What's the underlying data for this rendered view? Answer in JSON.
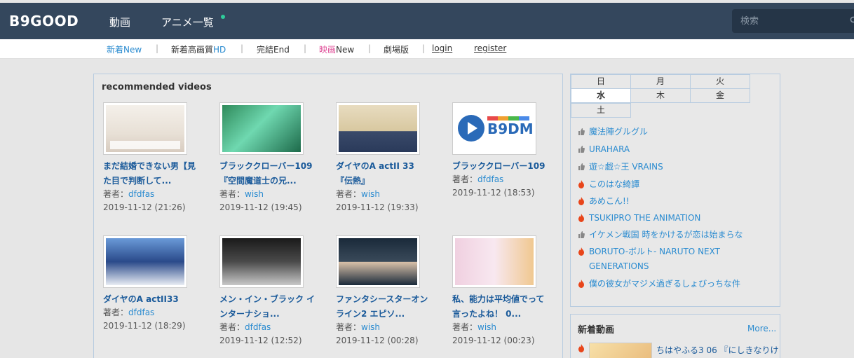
{
  "header": {
    "logo": "B9GOOD",
    "nav": [
      "動画",
      "アニメ一覧"
    ],
    "search_placeholder": "検索"
  },
  "subnav": {
    "items": [
      {
        "jp": "新着",
        "en": "New"
      },
      {
        "jp": "新着高画質",
        "en": "HD"
      },
      {
        "jp": "完結",
        "en": "End"
      },
      {
        "jp": "映画",
        "en": "New"
      },
      {
        "jp": "劇場版",
        "en": ""
      }
    ],
    "login": "login",
    "register": "register"
  },
  "recommended": {
    "title": "recommended videos",
    "author_label": "著者：",
    "videos": [
      {
        "title": "まだ結婚できない男【見た目で判断して...",
        "author": "dfdfas",
        "date": "2019-11-12 (21:26)"
      },
      {
        "title": "ブラッククローバー109『空間魔道士の兄...",
        "author": "wish",
        "date": "2019-11-12 (19:45)"
      },
      {
        "title": "ダイヤのA actII 33 『伝熱』",
        "author": "wish",
        "date": "2019-11-12 (19:33)"
      },
      {
        "title": "ブラッククローバー109",
        "author": "dfdfas",
        "date": "2019-11-12 (18:53)"
      },
      {
        "title": "ダイヤのA actII33",
        "author": "dfdfas",
        "date": "2019-11-12 (18:29)"
      },
      {
        "title": "メン・イン・ブラック インターナショ...",
        "author": "dfdfas",
        "date": "2019-11-12 (12:52)"
      },
      {
        "title": "ファンタシースターオンライン2 エピソ...",
        "author": "wish",
        "date": "2019-11-12 (00:28)"
      },
      {
        "title": "私、能力は平均値でって言ったよね！ 0...",
        "author": "wish",
        "date": "2019-11-12 (00:23)"
      }
    ],
    "thumb_logo": "B9DM"
  },
  "schedule": {
    "days": [
      "日",
      "月",
      "火",
      "水",
      "木",
      "金",
      "土"
    ],
    "active_day": "水",
    "anime": [
      {
        "title": "魔法陣グルグル",
        "icon": "thumb-icon"
      },
      {
        "title": "URAHARA",
        "icon": "thumb-icon"
      },
      {
        "title": "遊☆戯☆王 VRAINS",
        "icon": "thumb-icon"
      },
      {
        "title": "このはな綺譚",
        "icon": "fire-icon"
      },
      {
        "title": "あめこん!!",
        "icon": "fire-icon"
      },
      {
        "title": "TSUKIPRO THE ANIMATION",
        "icon": "fire-icon"
      },
      {
        "title": "イケメン戦国 時をかけるが恋は始まらな",
        "icon": "thumb-icon"
      },
      {
        "title": "BORUTO-ボルト- NARUTO NEXT GENERATIONS",
        "icon": "fire-icon"
      },
      {
        "title": "僕の彼女がマジメ過ぎるしょびっちな件",
        "icon": "fire-icon"
      }
    ]
  },
  "new_videos": {
    "title": "新着動画",
    "more": "More...",
    "first_title": "ちはやふる3 06 『にしきなりけ"
  },
  "colors": {
    "header_bg": "#34475d",
    "link": "#2a8bd0",
    "title_link": "#1a5a9a",
    "accent_dot": "#2ecc9b",
    "movie_pink": "#e0509a"
  }
}
